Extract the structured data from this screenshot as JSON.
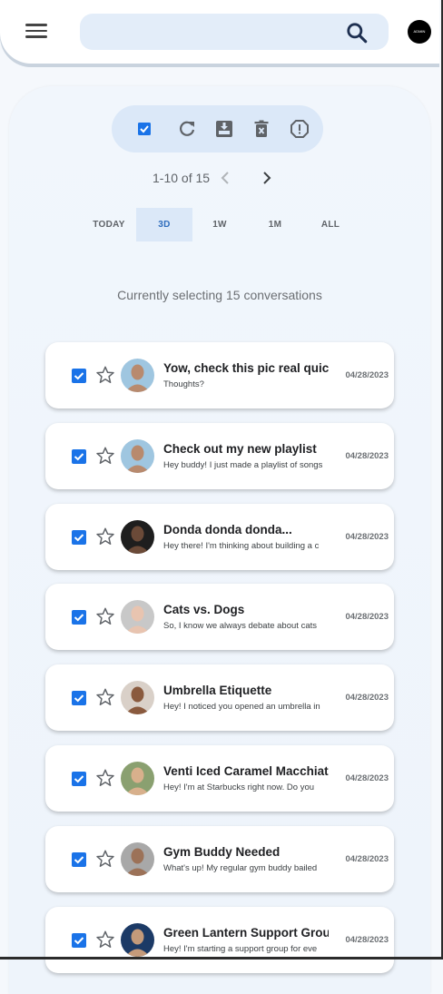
{
  "header": {
    "search_placeholder": "",
    "admin_label": "ADMIN"
  },
  "pager": {
    "range_text": "1-10 of 15"
  },
  "filters": [
    "TODAY",
    "3D",
    "1W",
    "1M",
    "ALL"
  ],
  "active_filter": "3D",
  "selection_text": "Currently selecting 15 conversations",
  "colors": {
    "accent": "#1a73e8",
    "toolbar_bg": "#dbe8f8",
    "search_bg": "#e3edf9"
  },
  "conversations": [
    {
      "title": "Yow, check this pic real quick",
      "snippet": "Thoughts?",
      "date": "04/28/2023",
      "checked": true,
      "starred": false,
      "avatar": {
        "bg": "#9fc6e0",
        "skin": "#b88a6e"
      }
    },
    {
      "title": "Check out my new playlist",
      "snippet": "Hey buddy! I just made a playlist of songs",
      "date": "04/28/2023",
      "checked": true,
      "starred": false,
      "avatar": {
        "bg": "#9fc6e0",
        "skin": "#b88a6e"
      }
    },
    {
      "title": "Donda donda donda...",
      "snippet": "Hey there! I'm thinking about building a c",
      "date": "04/28/2023",
      "checked": true,
      "starred": false,
      "avatar": {
        "bg": "#1e1e1e",
        "skin": "#6b4a38"
      }
    },
    {
      "title": "Cats vs. Dogs",
      "snippet": "So, I know we always debate about cats",
      "date": "04/28/2023",
      "checked": true,
      "starred": false,
      "avatar": {
        "bg": "#c8c8c8",
        "skin": "#e8c4b0"
      }
    },
    {
      "title": "Umbrella Etiquette",
      "snippet": "Hey! I noticed you opened an umbrella in",
      "date": "04/28/2023",
      "checked": true,
      "starred": false,
      "avatar": {
        "bg": "#d9d0c8",
        "skin": "#8a5a3e"
      }
    },
    {
      "title": "Venti Iced Caramel Macchiato",
      "snippet": "Hey! I'm at Starbucks right now. Do you",
      "date": "04/28/2023",
      "checked": true,
      "starred": false,
      "avatar": {
        "bg": "#8aa070",
        "skin": "#d8b08c"
      }
    },
    {
      "title": "Gym Buddy Needed",
      "snippet": "What's up! My regular gym buddy bailed",
      "date": "04/28/2023",
      "checked": true,
      "starred": false,
      "avatar": {
        "bg": "#a8a8a8",
        "skin": "#9c7258"
      }
    },
    {
      "title": "Green Lantern Support Group",
      "snippet": "Hey! I'm starting a support group for eve",
      "date": "04/28/2023",
      "checked": true,
      "starred": false,
      "avatar": {
        "bg": "#1c3a66",
        "skin": "#c49a7a"
      }
    }
  ]
}
